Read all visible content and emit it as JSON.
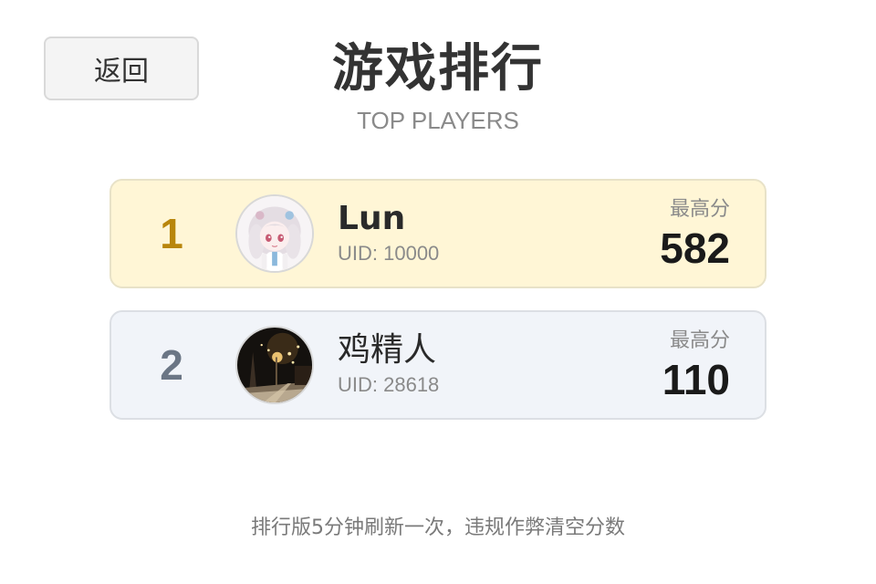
{
  "header": {
    "back_label": "返回",
    "title": "游戏排行",
    "subtitle": "TOP PLAYERS"
  },
  "leaderboard": [
    {
      "rank": "1",
      "name": "Lun",
      "uid": "UID: 10000",
      "score_label": "最高分",
      "score": "582",
      "avatar_icon": "anime-girl-avatar",
      "accent": "#b8860b",
      "background": "#fff6d6"
    },
    {
      "rank": "2",
      "name": "鸡精人",
      "uid": "UID: 28618",
      "score_label": "最高分",
      "score": "110",
      "avatar_icon": "night-street-avatar",
      "accent": "#6b7685",
      "background": "#f1f4f9"
    }
  ],
  "footer": {
    "note": "排行版5分钟刷新一次，违规作弊清空分数"
  }
}
